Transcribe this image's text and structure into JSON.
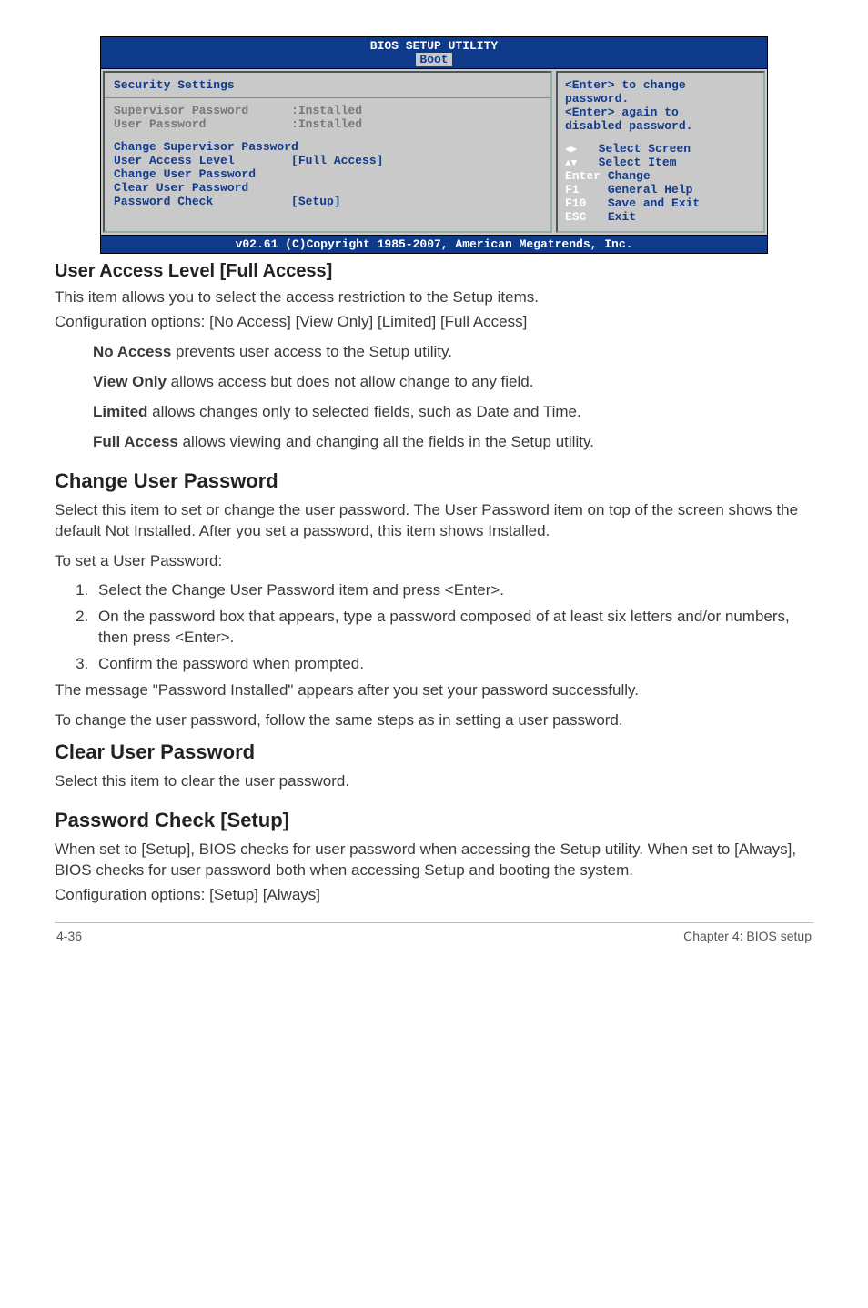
{
  "bios": {
    "title": "BIOS SETUP UTILITY",
    "tab": "Boot",
    "section_heading": "Security Settings",
    "sup_pw_label": "Supervisor Password",
    "sup_pw_val": ":Installed",
    "user_pw_label": "User Password",
    "user_pw_val": ":Installed",
    "item_change_sup": "Change Supervisor Password",
    "item_ual_label": "User Access Level",
    "item_ual_val": "[Full Access]",
    "item_change_user": "Change User Password",
    "item_clear_user": "Clear User Password",
    "item_pwcheck_label": "Password Check",
    "item_pwcheck_val": "[Setup]",
    "help_line1": "<Enter> to change",
    "help_line2": "password.",
    "help_line3": "<Enter> again to",
    "help_line4": "disabled password.",
    "nav_select_screen": "Select Screen",
    "nav_select_item": "Select Item",
    "nav_enter_key": "Enter",
    "nav_enter_label": "Change",
    "nav_f1_key": "F1",
    "nav_f1_label": "General Help",
    "nav_f10_key": "F10",
    "nav_f10_label": "Save and Exit",
    "nav_esc_key": "ESC",
    "nav_esc_label": "Exit",
    "footer": "v02.61 (C)Copyright 1985-2007, American Megatrends, Inc."
  },
  "sections": {
    "ual_heading": "User Access Level [Full Access]",
    "ual_p1": "This item allows you to select the access restriction to the Setup items.",
    "ual_p2": "Configuration options: [No Access] [View Only] [Limited] [Full Access]",
    "noaccess_bold": "No Access",
    "noaccess_rest": " prevents user access to the Setup utility.",
    "viewonly_bold": "View Only",
    "viewonly_rest": " allows access but does not allow change to any field.",
    "limited_bold": "Limited",
    "limited_rest": " allows changes only to selected fields, such as Date and Time.",
    "fullaccess_bold": "Full Access",
    "fullaccess_rest": " allows viewing and changing all the fields in the Setup utility.",
    "cup_heading": "Change User Password",
    "cup_p1": "Select this item to set or change the user password. The User Password item on top of the screen shows the default Not Installed. After you set a password, this item shows Installed.",
    "cup_p2": "To set a User Password:",
    "cup_step1": "Select the Change User Password item and press <Enter>.",
    "cup_step2": "On the password box that appears, type a password composed of at least six letters and/or numbers, then press <Enter>.",
    "cup_step3": "Confirm the password when prompted.",
    "cup_p3": "The message \"Password Installed\" appears after you set your password successfully.",
    "cup_p4": "To change the user password, follow the same steps as in setting a user password.",
    "clr_heading": "Clear User Password",
    "clr_p1": "Select this item to clear the user password.",
    "pwc_heading": "Password Check [Setup]",
    "pwc_p1": "When set to [Setup], BIOS checks for user password when accessing the Setup utility. When set to [Always], BIOS checks for user password both when accessing Setup and booting the system.",
    "pwc_p2": "Configuration options: [Setup] [Always]"
  },
  "footer": {
    "left": "4-36",
    "right": "Chapter 4: BIOS setup"
  }
}
